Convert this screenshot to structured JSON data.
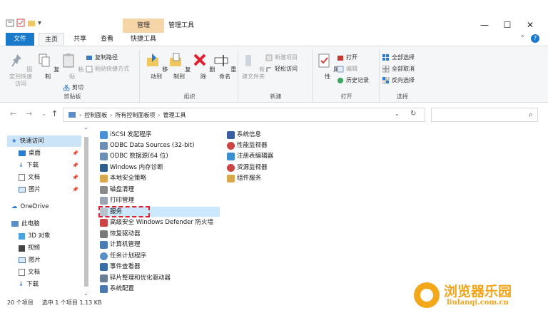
{
  "window": {
    "title": "管理工具",
    "context_tab": "管理",
    "controls": {
      "minimize": "—",
      "maximize": "☐",
      "close": "✕"
    }
  },
  "tabs": {
    "file": "文件",
    "home": "主页",
    "share": "共享",
    "view": "查看",
    "manage": "快捷工具"
  },
  "ribbon": {
    "clipboard": {
      "label": "剪贴板",
      "pin_quick": "固定到快速访问",
      "copy": "复制",
      "paste": "粘贴",
      "copy_path": "复制路径",
      "paste_shortcut": "粘贴快捷方式",
      "cut": "剪切"
    },
    "organize": {
      "label": "组织",
      "move_to": "移动到",
      "copy_to": "复制到",
      "delete": "删除",
      "rename": "重命名"
    },
    "new": {
      "label": "新建",
      "new_folder": "新建文件夹",
      "new_item": "新建项目",
      "easy_access": "轻松访问"
    },
    "open": {
      "label": "打开",
      "properties": "属性",
      "open": "打开",
      "edit": "编辑",
      "history": "历史记录"
    },
    "select": {
      "label": "选择",
      "select_all": "全部选择",
      "select_none": "全部取消",
      "invert": "反向选择"
    }
  },
  "address": {
    "back": "←",
    "forward": "→",
    "recent": "⌄",
    "up": "↑",
    "crumbs": [
      "控制面板",
      "所有控制面板项",
      "管理工具"
    ],
    "dropdown": "⌄",
    "refresh": "↻",
    "search_icon": "⌕"
  },
  "nav": {
    "items": [
      {
        "label": "快速访问"
      },
      {
        "label": "桌面"
      },
      {
        "label": "下载"
      },
      {
        "label": "文档"
      },
      {
        "label": "图片"
      },
      {
        "label": "OneDrive"
      },
      {
        "label": "此电脑"
      },
      {
        "label": "3D 对象"
      },
      {
        "label": "视频"
      },
      {
        "label": "图片"
      },
      {
        "label": "文档"
      },
      {
        "label": "下载"
      }
    ]
  },
  "files": {
    "col1": [
      "iSCSI 发起程序",
      "ODBC Data Sources (32-bit)",
      "ODBC 数据源(64 位)",
      "Windows 内存诊断",
      "本地安全策略",
      "磁盘清理",
      "打印管理",
      "服务",
      "高级安全 Windows Defender 防火墙",
      "恢复驱动器",
      "计算机管理",
      "任务计划程序",
      "事件查看器",
      "碎片整理和优化驱动器",
      "系统配置"
    ],
    "col2": [
      "系统信息",
      "性能监视器",
      "注册表编辑器",
      "资源监视器",
      "组件服务"
    ]
  },
  "status": {
    "count": "20 个项目",
    "selected": "选中 1 个项目  1.13 KB"
  },
  "watermark": {
    "title": "浏览器乐园",
    "url": "liulanqi.com.cn"
  },
  "colors": {
    "accent": "#1979ca",
    "selection": "#cce8ff",
    "highlight": "#e0202e"
  }
}
